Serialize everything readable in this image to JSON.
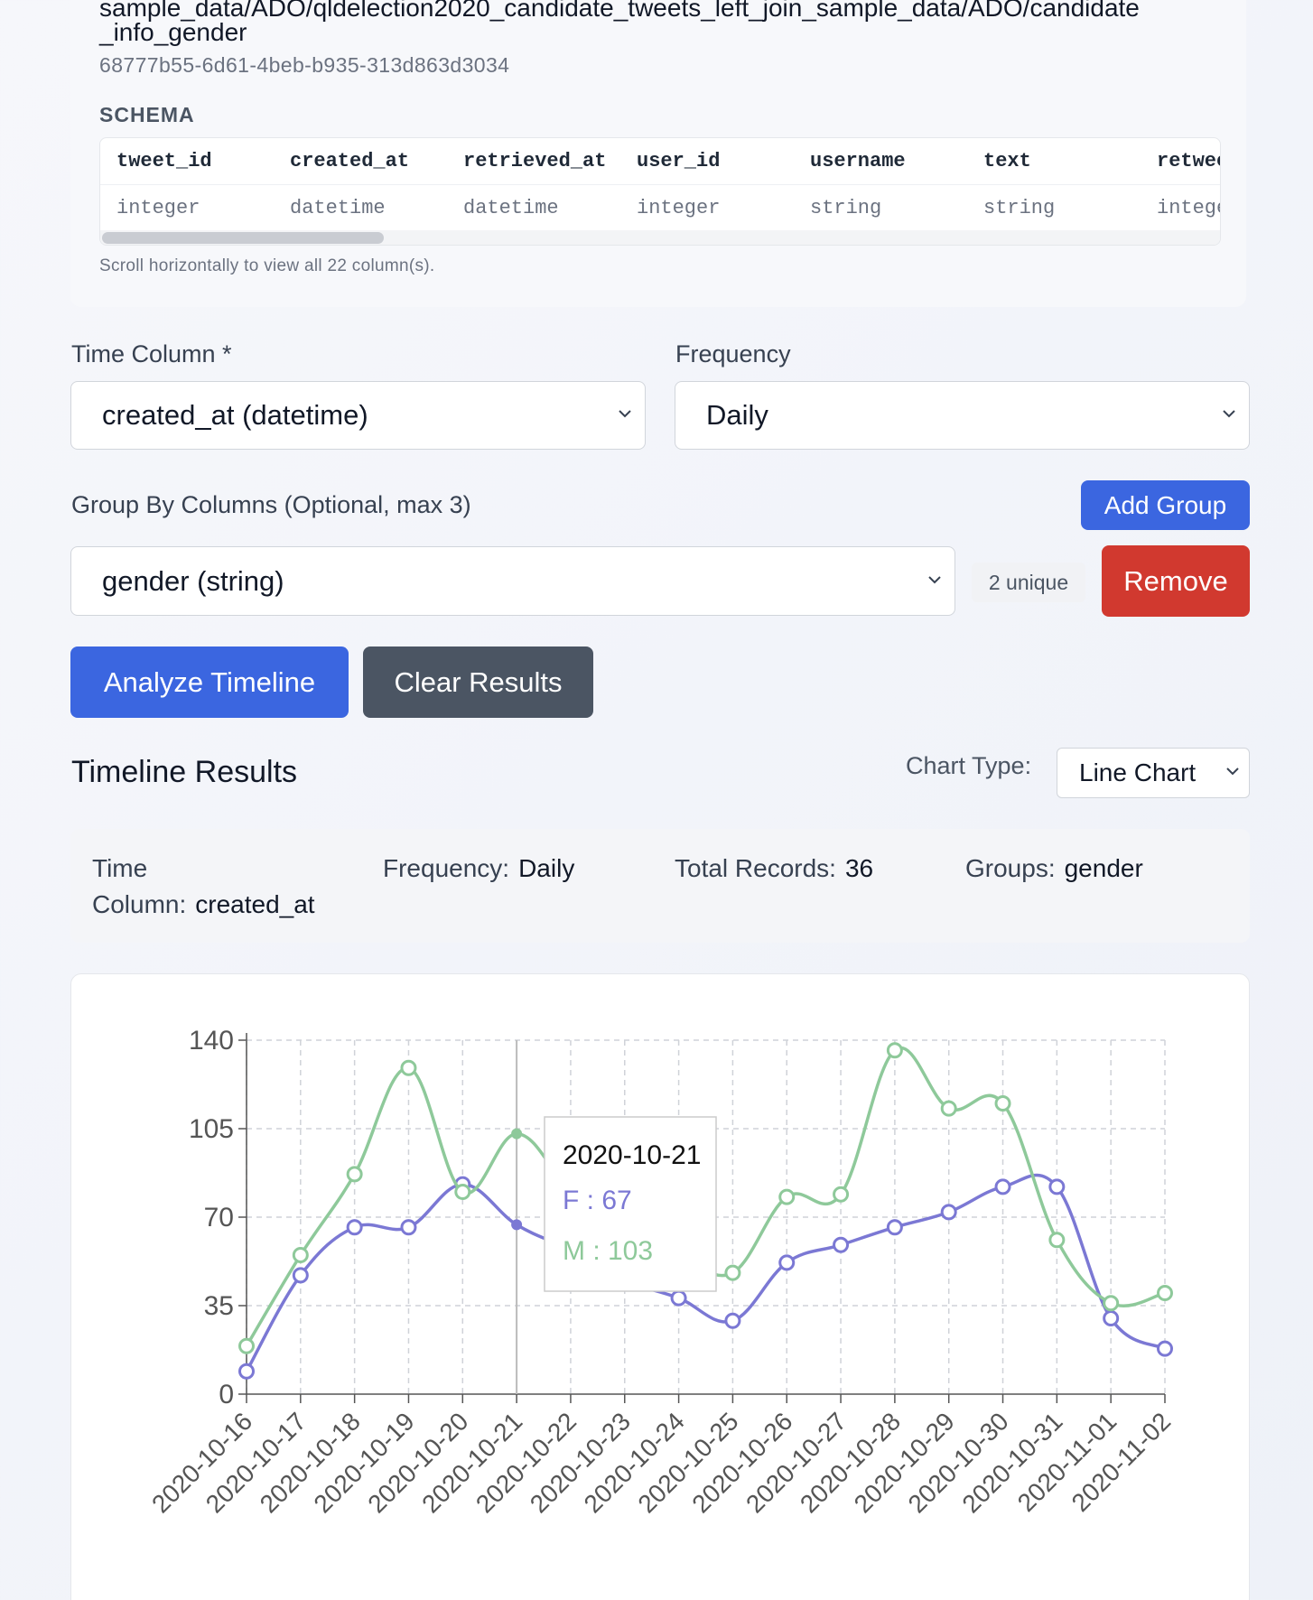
{
  "dataset": {
    "path_line1": "sample_data/ADO/qldelection2020_candidate_tweets_left_join_sample_data/ADO/candidate",
    "path_line2": "_info_gender",
    "id": "68777b55-6d61-4beb-b935-313d863d3034",
    "schema_label": "SCHEMA",
    "columns": [
      {
        "name": "tweet_id",
        "type": "integer"
      },
      {
        "name": "created_at",
        "type": "datetime"
      },
      {
        "name": "retrieved_at",
        "type": "datetime"
      },
      {
        "name": "user_id",
        "type": "integer"
      },
      {
        "name": "username",
        "type": "string"
      },
      {
        "name": "text",
        "type": "string"
      },
      {
        "name": "retweet",
        "type": "integer"
      }
    ],
    "scroll_hint": "Scroll horizontally to view all 22 column(s)."
  },
  "form": {
    "time_column_label": "Time Column *",
    "time_column_value": "created_at (datetime)",
    "frequency_label": "Frequency",
    "frequency_value": "Daily",
    "group_by_label": "Group By Columns (Optional, max 3)",
    "add_group_label": "Add Group",
    "group_value": "gender (string)",
    "unique_badge": "2 unique",
    "remove_label": "Remove",
    "analyze_label": "Analyze Timeline",
    "clear_label": "Clear Results"
  },
  "results": {
    "title": "Timeline Results",
    "chart_type_label": "Chart Type:",
    "chart_type_value": "Line Chart",
    "summary": {
      "time_column_label_1": "Time",
      "time_column_label_2": "Column:",
      "time_column_value": "created_at",
      "frequency_label": "Frequency:",
      "frequency_value": "Daily",
      "total_records_label": "Total Records:",
      "total_records_value": "36",
      "groups_label": "Groups:",
      "groups_value": "gender"
    }
  },
  "tooltip": {
    "date": "2020-10-21",
    "line_f": "F : 67",
    "line_m": "M : 103"
  },
  "colors": {
    "series_f": "#7b78d4",
    "series_m": "#8ec99a",
    "primary": "#3b66e0",
    "danger": "#d1392f"
  },
  "chart_data": {
    "type": "line",
    "x": [
      "2020-10-16",
      "2020-10-17",
      "2020-10-18",
      "2020-10-19",
      "2020-10-20",
      "2020-10-21",
      "2020-10-22",
      "2020-10-23",
      "2020-10-24",
      "2020-10-25",
      "2020-10-26",
      "2020-10-27",
      "2020-10-28",
      "2020-10-29",
      "2020-10-30",
      "2020-10-31",
      "2020-11-01",
      "2020-11-02"
    ],
    "ylim": [
      0,
      140
    ],
    "yticks": [
      0,
      35,
      70,
      105,
      140
    ],
    "series": [
      {
        "name": "F",
        "values": [
          9,
          47,
          66,
          66,
          83,
          67,
          57,
          45,
          38,
          29,
          52,
          59,
          66,
          72,
          82,
          82,
          30,
          18
        ]
      },
      {
        "name": "M",
        "values": [
          19,
          55,
          87,
          129,
          80,
          103,
          80,
          62,
          55,
          48,
          78,
          79,
          136,
          113,
          115,
          61,
          36,
          40
        ]
      }
    ],
    "grid": true,
    "highlight_index": 5
  }
}
